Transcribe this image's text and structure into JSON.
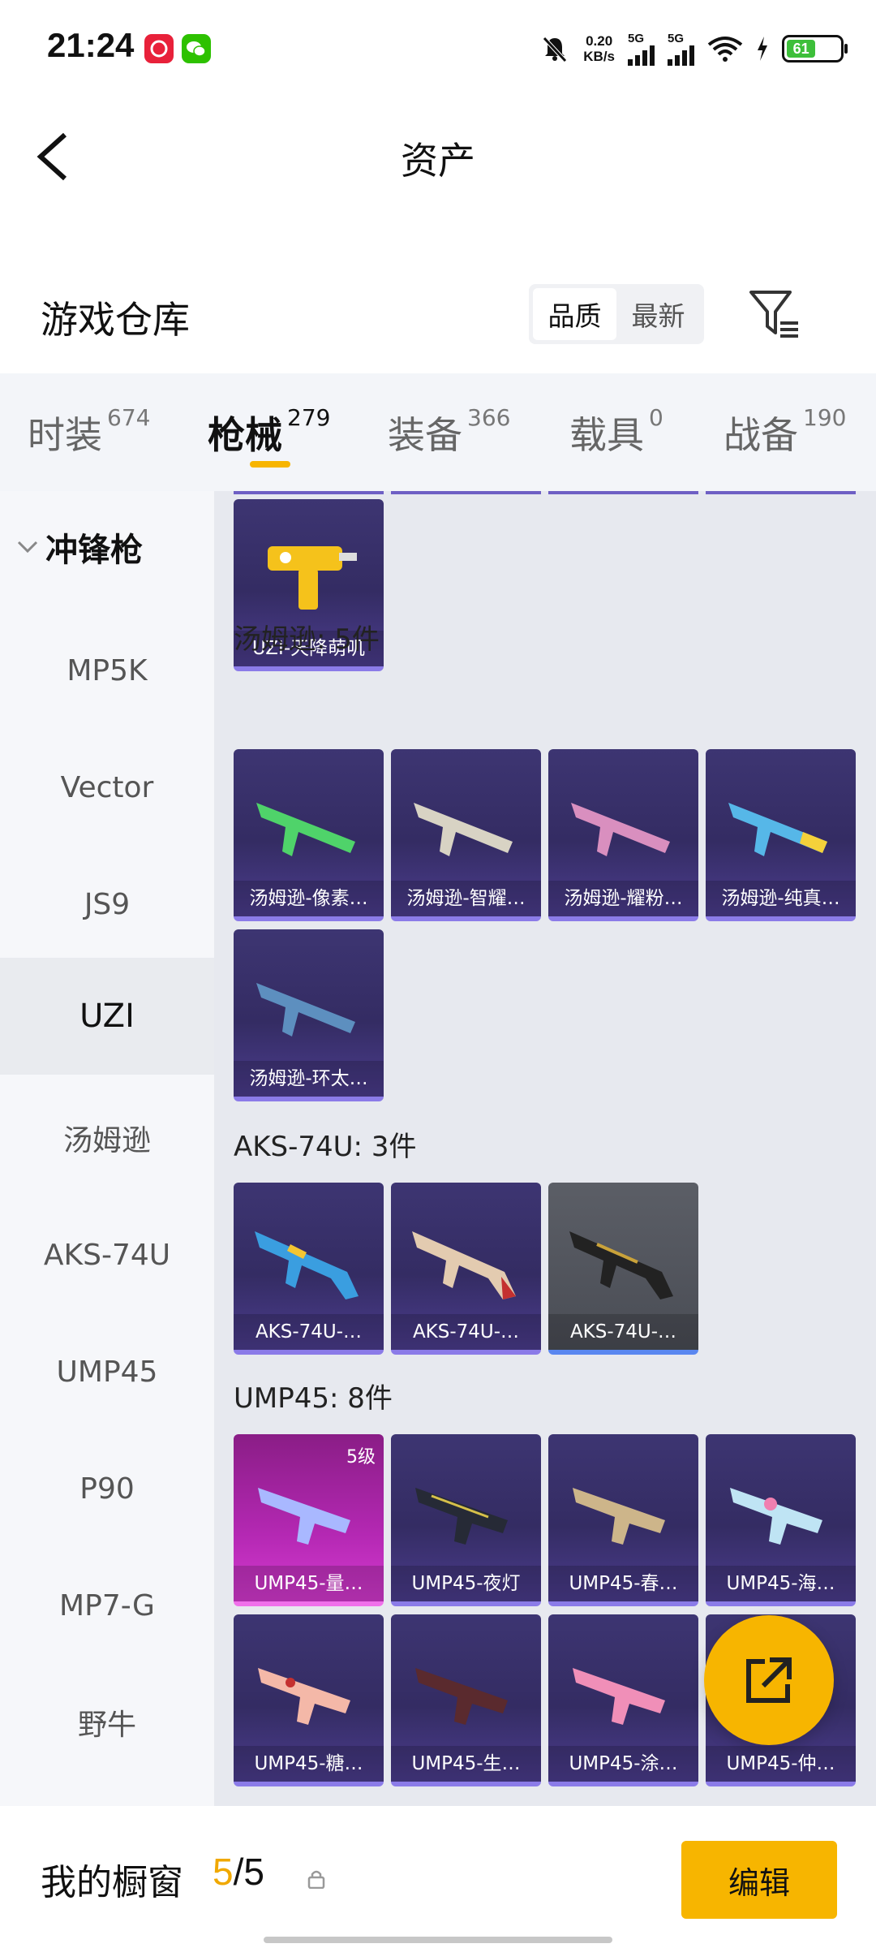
{
  "status": {
    "time": "21:24",
    "net_speed_value": "0.20",
    "net_speed_unit": "KB/s",
    "sig1": "5G",
    "sig2": "5G",
    "battery": "61"
  },
  "header": {
    "title": "资产"
  },
  "warehouse": {
    "title": "游戏仓库",
    "sort_quality": "品质",
    "sort_newest": "最新"
  },
  "tabs": [
    {
      "label": "时装",
      "count": "674"
    },
    {
      "label": "枪械",
      "count": "279"
    },
    {
      "label": "装备",
      "count": "366"
    },
    {
      "label": "载具",
      "count": "0"
    },
    {
      "label": "战备",
      "count": "190"
    }
  ],
  "sidenav": {
    "group": "冲锋枪",
    "items": [
      "MP5K",
      "Vector",
      "JS9",
      "UZI",
      "汤姆逊",
      "AKS-74U",
      "UMP45",
      "P90",
      "MP7-G",
      "野牛"
    ],
    "active": "UZI"
  },
  "sections": {
    "uzi": {
      "items": [
        "UZI-天降萌叽"
      ]
    },
    "thompson": {
      "title": "汤姆逊: 5件",
      "items": [
        "汤姆逊-像素…",
        "汤姆逊-智耀…",
        "汤姆逊-耀粉…",
        "汤姆逊-纯真…",
        "汤姆逊-环太…"
      ]
    },
    "aks": {
      "title": "AKS-74U: 3件",
      "items": [
        "AKS-74U-…",
        "AKS-74U-…",
        "AKS-74U-…"
      ]
    },
    "ump": {
      "title": "UMP45: 8件",
      "level_badge": "5级",
      "items": [
        "UMP45-量…",
        "UMP45-夜灯",
        "UMP45-春…",
        "UMP45-海…",
        "UMP45-糖…",
        "UMP45-生…",
        "UMP45-涂…",
        "UMP45-仲…"
      ]
    }
  },
  "bottom": {
    "title": "我的橱窗",
    "count_current": "5",
    "count_total": "/5",
    "edit": "编辑"
  },
  "colors": {
    "accent": "#f7b500",
    "card": "#3d3572",
    "rare_pink": "#b428b3"
  }
}
